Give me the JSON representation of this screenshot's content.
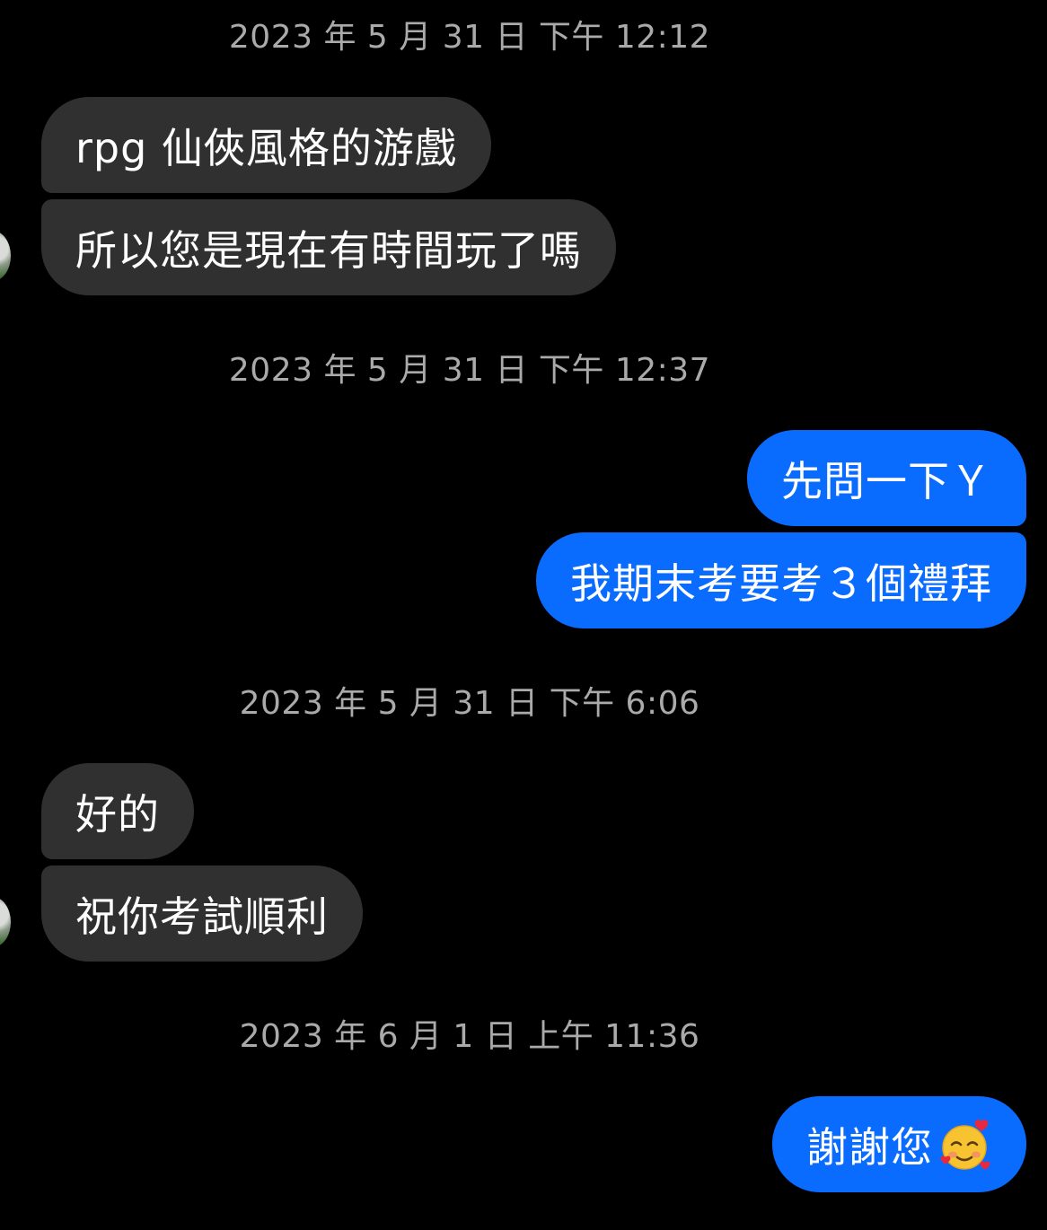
{
  "conversation": {
    "messages": [
      {
        "type": "timestamp",
        "text": "2023 年 5 月 31 日 下午 12:12"
      },
      {
        "type": "incoming",
        "text": "rpg 仙俠風格的游戲"
      },
      {
        "type": "incoming",
        "text": "所以您是現在有時間玩了嗎"
      },
      {
        "type": "timestamp",
        "text": "2023 年 5 月 31 日 下午 12:37"
      },
      {
        "type": "outgoing",
        "text": "先問一下Ｙ"
      },
      {
        "type": "outgoing",
        "text": "我期末考要考３個禮拜"
      },
      {
        "type": "timestamp",
        "text": "2023 年 5 月 31 日 下午 6:06"
      },
      {
        "type": "incoming",
        "text": "好的"
      },
      {
        "type": "incoming",
        "text": "祝你考試順利"
      },
      {
        "type": "timestamp",
        "text": "2023 年 6 月 1 日 上午 11:36"
      },
      {
        "type": "outgoing",
        "text": "謝謝您",
        "emoji": "smiling-face-with-hearts"
      }
    ]
  },
  "colors": {
    "background": "#000000",
    "incoming_bubble": "#303030",
    "outgoing_bubble": "#0a6cff",
    "timestamp_text": "#aaaaaa"
  }
}
